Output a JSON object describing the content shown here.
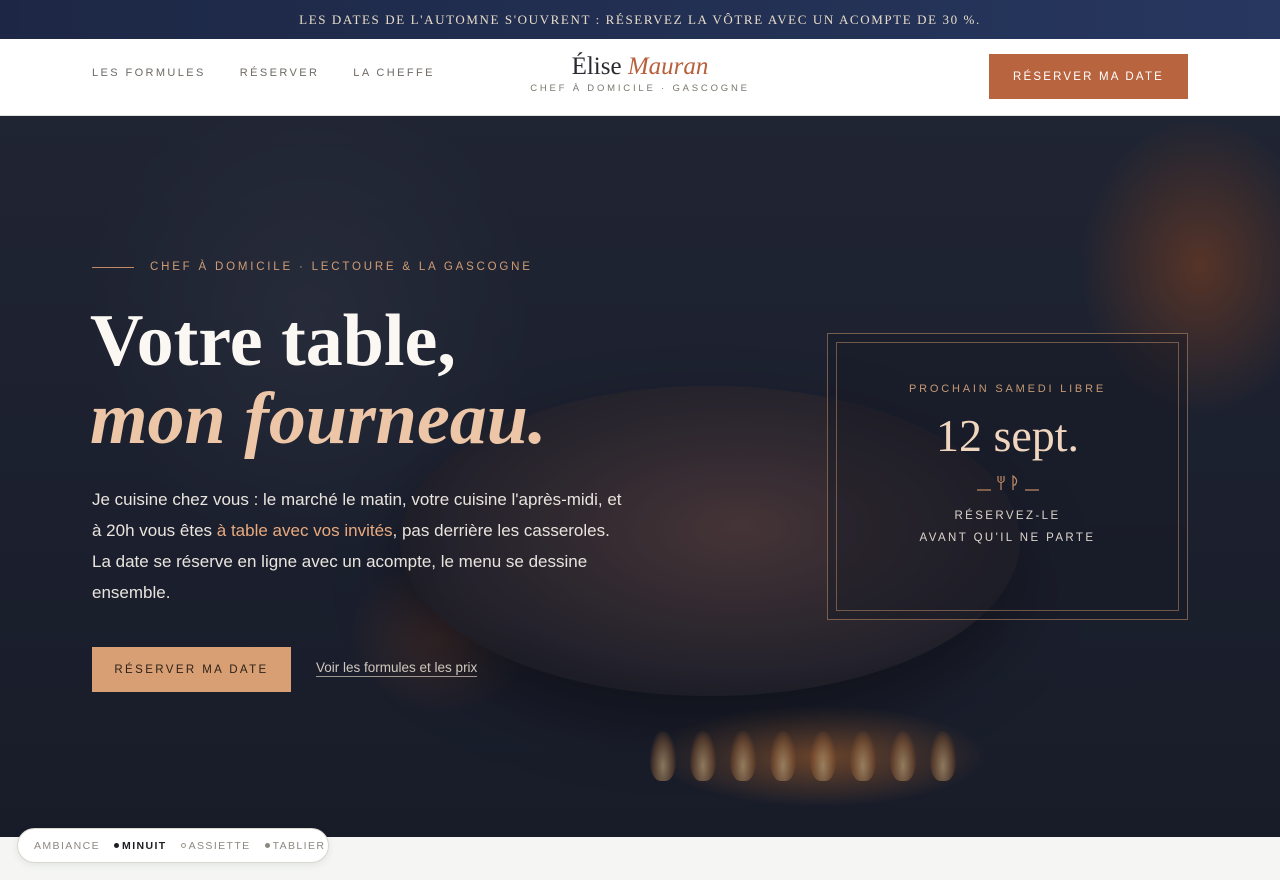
{
  "announcement": "LES DATES DE L'AUTOMNE S'OUVRENT : RÉSERVEZ LA VÔTRE AVEC UN ACOMPTE DE 30 %.",
  "nav": {
    "links": [
      "LES FORMULES",
      "RÉSERVER",
      "LA CHEFFE"
    ],
    "logo_first": "Élise",
    "logo_last": "Mauran",
    "logo_sub": "CHEF À DOMICILE · GASCOGNE",
    "cta": "RÉSERVER MA DATE"
  },
  "hero": {
    "kicker": "CHEF À DOMICILE · LECTOURE & LA GASCOGNE",
    "title_line1": "Votre table,",
    "title_line2": "mon fourneau.",
    "lead_part1": "Je cuisine chez vous : le marché le matin, votre cuisine l'après-midi, et à 20h vous êtes ",
    "lead_highlight": "à table avec vos invités",
    "lead_part2": ", pas derrière les casseroles. La date se réserve en ligne avec un acompte, le menu se dessine ensemble.",
    "cta": "RÉSERVER MA DATE",
    "secondary_link": "Voir les formules et les prix"
  },
  "availability_card": {
    "label": "PROCHAIN SAMEDI LIBRE",
    "date": "12 sept.",
    "icon": "cutlery-icon",
    "message_line1": "RÉSERVEZ-LE",
    "message_line2": "AVANT QU'IL NE PARTE"
  },
  "theme_switcher": {
    "label": "AMBIANCE",
    "options": [
      {
        "label": "MINUIT",
        "active": true
      },
      {
        "label": "ASSIETTE",
        "active": false
      },
      {
        "label": "TABLIER",
        "active": false
      }
    ]
  },
  "colors": {
    "accent": "#b8643f",
    "hero_accent": "#d89e74",
    "announcement_bg": "#1d2745"
  }
}
